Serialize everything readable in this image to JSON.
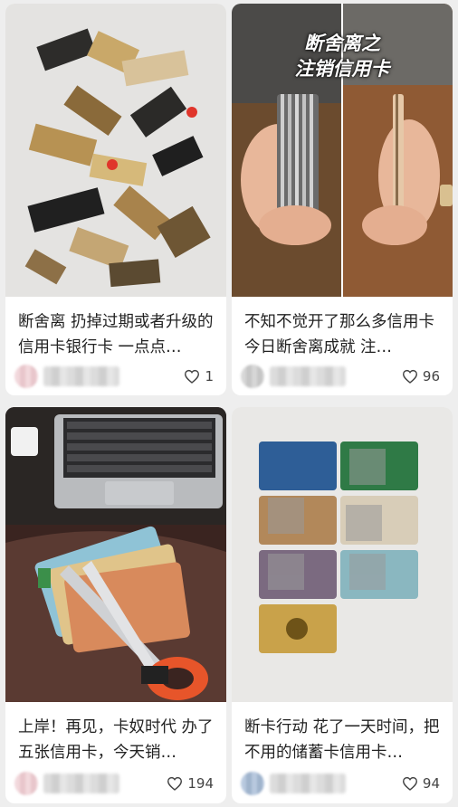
{
  "feed": {
    "posts": [
      {
        "overlay_text": [],
        "title": "断舍离 扔掉过期或者升级的信用卡银行卡 一点点…",
        "likes": "1",
        "icon": "heart-icon"
      },
      {
        "overlay_text": [
          "断舍离之",
          "注销信用卡"
        ],
        "title": "不知不觉开了那么多信用卡 今日断舍离成就 注…",
        "likes": "96",
        "icon": "heart-icon"
      },
      {
        "overlay_text": [],
        "title": "上岸！再见，卡奴时代 办了五张信用卡，今天销…",
        "likes": "194",
        "icon": "heart-icon"
      },
      {
        "overlay_text": [],
        "title": "断卡行动 花了一天时间，把不用的储蓄卡信用卡…",
        "likes": "94",
        "icon": "heart-icon"
      }
    ]
  }
}
